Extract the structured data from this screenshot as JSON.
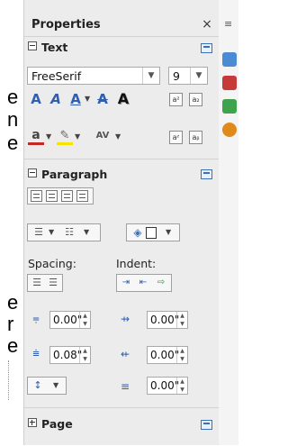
{
  "document_fragment": {
    "lines_1": [
      "e",
      "n",
      "e"
    ],
    "lines_2": [
      "e",
      "r",
      "e"
    ]
  },
  "sidebar": {
    "title": "Properties",
    "close_glyph": "×",
    "menu_glyph": "≡"
  },
  "text_section": {
    "header": "Text",
    "font_name": "FreeSerif",
    "font_size": "9",
    "icons": [
      "grow-font-icon",
      "shrink-font-icon",
      "underline-icon",
      "strikethrough-icon",
      "shadow-icon",
      "superscript-icon",
      "subscript-icon",
      "font-color-icon",
      "highlight-color-icon",
      "character-spacing-icon"
    ]
  },
  "paragraph_section": {
    "header": "Paragraph",
    "spacing_label": "Spacing:",
    "indent_label": "Indent:",
    "above_spacing": "0.00\"",
    "below_spacing": "0.08\"",
    "before_indent": "0.00\"",
    "after_indent": "0.00\"",
    "first_line_indent": "0.00\""
  },
  "page_section": {
    "header": "Page"
  },
  "colors": {
    "panel_bg": "#ececec",
    "accent_blue": "#3b6fb6",
    "font_color_red": "#c62828",
    "highlight_yellow": "#f5e400"
  },
  "deck": {
    "icons": [
      "properties-deck-icon",
      "styles-deck-icon",
      "gallery-deck-icon",
      "navigator-deck-icon"
    ]
  }
}
